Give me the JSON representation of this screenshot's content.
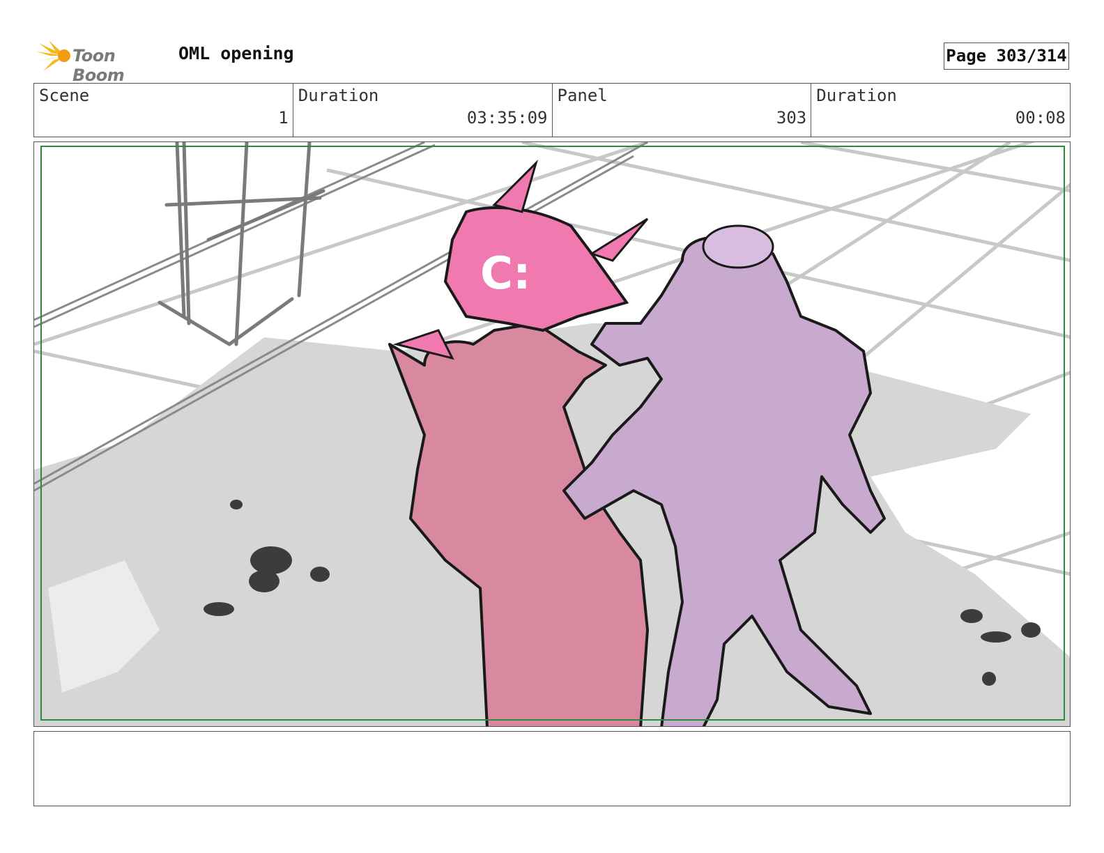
{
  "header": {
    "logo_text": "Toon Boom",
    "project_title": "OML opening",
    "page_label": "Page 303/314"
  },
  "info": {
    "scene_label": "Scene",
    "scene_value": "1",
    "scene_duration_label": "Duration",
    "scene_duration_value": "03:35:09",
    "panel_label": "Panel",
    "panel_value": "303",
    "panel_duration_label": "Duration",
    "panel_duration_value": "00:08"
  },
  "colors": {
    "robot_pink": "#d9899f",
    "robot_head_pink": "#f07ab0",
    "girl_lavender": "#c9aacf",
    "shadow_gray": "#d6d6d6",
    "sketch_gray": "#8a8a8a",
    "safe_frame_green": "#2e8b3a"
  },
  "panel": {
    "image_description_icon": "storyboard-sketch"
  }
}
